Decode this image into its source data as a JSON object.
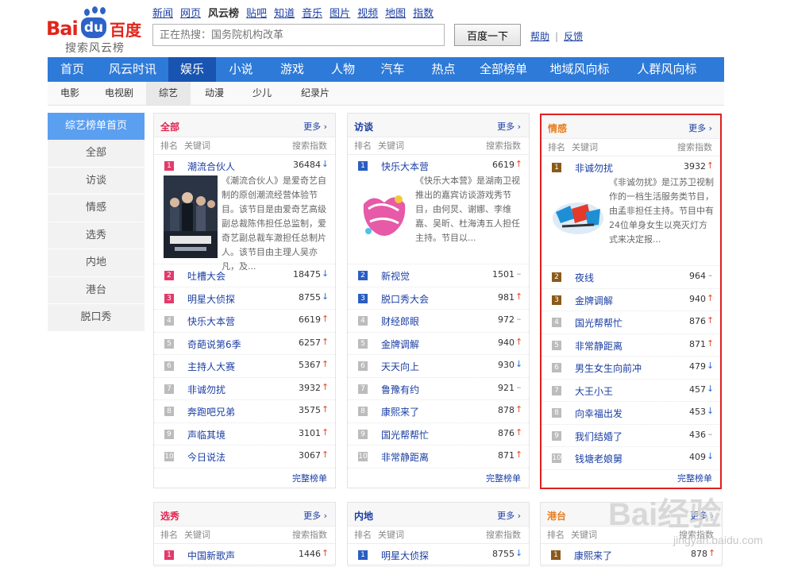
{
  "header": {
    "logo": {
      "bai": "Bai",
      "du": "du",
      "baidu_cn": "百度",
      "subtitle": "搜索风云榜"
    },
    "channels": [
      "新闻",
      "网页",
      "风云榜",
      "贴吧",
      "知道",
      "音乐",
      "图片",
      "视频",
      "地图",
      "指数"
    ],
    "current_channel": "风云榜",
    "search": {
      "placeholder": "正在热搜：国务院机构改革",
      "button": "百度一下"
    },
    "help": "帮助",
    "feedback": "反馈"
  },
  "main_nav": [
    "首页",
    "风云时讯",
    "娱乐",
    "小说",
    "游戏",
    "人物",
    "汽车",
    "热点",
    "全部榜单",
    "地域风向标",
    "人群风向标"
  ],
  "main_nav_active": "娱乐",
  "sub_nav": [
    "电影",
    "电视剧",
    "综艺",
    "动漫",
    "少儿",
    "纪录片"
  ],
  "sub_nav_active": "综艺",
  "sidebar": {
    "head": "综艺榜单首页",
    "items": [
      "全部",
      "访谈",
      "情感",
      "选秀",
      "内地",
      "港台",
      "脱口秀"
    ]
  },
  "common": {
    "more": "更多",
    "rank": "排名",
    "keyword": "关键词",
    "index": "搜索指数",
    "full_list": "完整榜单"
  },
  "colors": {
    "nav_blue": "#2e7ad8",
    "nav_active": "#1854b0",
    "rank_top1": "#e33a6c",
    "rank_top1_gold": "#8b5a1b",
    "rank_top1_blue": "#2b5ec2",
    "highlight_border": "#e02020",
    "up": "#e24a2d",
    "down": "#2f6cd8"
  },
  "panels": [
    {
      "title": "全部",
      "title_color": "#e0244e",
      "rank_color": "#e33a6c",
      "featured": {
        "rank": "1",
        "name": "潮流合伙人",
        "value": "36484",
        "trend": "down",
        "image": "poster-chaoliu-hehuoren",
        "desc": "《潮流合伙人》是爱奇艺自制的原创潮流经营体验节目。该节目是由爱奇艺高级副总裁陈伟担任总监制，爱奇艺副总裁车澈担任总制片人。该节目由主理人吴亦凡，及..."
      },
      "rows": [
        {
          "rank": "2",
          "name": "吐槽大会",
          "value": "18475",
          "trend": "down"
        },
        {
          "rank": "3",
          "name": "明星大侦探",
          "value": "8755",
          "trend": "down"
        },
        {
          "rank": "4",
          "name": "快乐大本营",
          "value": "6619",
          "trend": "up"
        },
        {
          "rank": "5",
          "name": "奇葩说第6季",
          "value": "6257",
          "trend": "up"
        },
        {
          "rank": "6",
          "name": "主持人大赛",
          "value": "5367",
          "trend": "up"
        },
        {
          "rank": "7",
          "name": "非诚勿扰",
          "value": "3932",
          "trend": "up"
        },
        {
          "rank": "8",
          "name": "奔跑吧兄弟",
          "value": "3575",
          "trend": "up"
        },
        {
          "rank": "9",
          "name": "声临其境",
          "value": "3101",
          "trend": "up"
        },
        {
          "rank": "10",
          "name": "今日说法",
          "value": "3067",
          "trend": "up"
        }
      ]
    },
    {
      "title": "访谈",
      "title_color": "#1a3ea3",
      "rank_color": "#2b5ec2",
      "featured": {
        "rank": "1",
        "name": "快乐大本营",
        "value": "6619",
        "trend": "up",
        "image": "logo-kuaile-dabenying",
        "desc": "《快乐大本营》是湖南卫视推出的嘉宾访谈游戏秀节目，由何炅、谢娜、李维嘉、吴昕、杜海涛五人担任主持。节目以..."
      },
      "rows": [
        {
          "rank": "2",
          "name": "新视觉",
          "value": "1501",
          "trend": "flat"
        },
        {
          "rank": "3",
          "name": "脱口秀大会",
          "value": "981",
          "trend": "up"
        },
        {
          "rank": "4",
          "name": "财经郎眼",
          "value": "972",
          "trend": "flat"
        },
        {
          "rank": "5",
          "name": "金牌调解",
          "value": "940",
          "trend": "up"
        },
        {
          "rank": "6",
          "name": "天天向上",
          "value": "930",
          "trend": "down"
        },
        {
          "rank": "7",
          "name": "鲁豫有约",
          "value": "921",
          "trend": "flat"
        },
        {
          "rank": "8",
          "name": "康熙来了",
          "value": "878",
          "trend": "up"
        },
        {
          "rank": "9",
          "name": "国光帮帮忙",
          "value": "876",
          "trend": "up"
        },
        {
          "rank": "10",
          "name": "非常静距离",
          "value": "871",
          "trend": "up"
        }
      ]
    },
    {
      "title": "情感",
      "title_color": "#e67e1e",
      "rank_color": "#8b5a1b",
      "featured": {
        "rank": "1",
        "name": "非诚勿扰",
        "value": "3932",
        "trend": "up",
        "image": "logo-feicheng-wurao",
        "desc": "《非诚勿扰》是江苏卫视制作的一档生活服务类节目，由孟非担任主持。节目中有24位单身女生以亮灭灯方式来决定报..."
      },
      "rows": [
        {
          "rank": "2",
          "name": "夜线",
          "value": "964",
          "trend": "flat"
        },
        {
          "rank": "3",
          "name": "金牌调解",
          "value": "940",
          "trend": "up"
        },
        {
          "rank": "4",
          "name": "国光帮帮忙",
          "value": "876",
          "trend": "up"
        },
        {
          "rank": "5",
          "name": "非常静距离",
          "value": "871",
          "trend": "up"
        },
        {
          "rank": "6",
          "name": "男生女生向前冲",
          "value": "479",
          "trend": "down"
        },
        {
          "rank": "7",
          "name": "大王小王",
          "value": "457",
          "trend": "down"
        },
        {
          "rank": "8",
          "name": "向幸福出发",
          "value": "453",
          "trend": "down"
        },
        {
          "rank": "9",
          "name": "我们结婚了",
          "value": "436",
          "trend": "flat"
        },
        {
          "rank": "10",
          "name": "钱塘老娘舅",
          "value": "409",
          "trend": "down"
        }
      ]
    }
  ],
  "bottom_panels": [
    {
      "title": "选秀",
      "title_color": "#e0244e",
      "rank_color": "#e33a6c",
      "first": {
        "rank": "1",
        "name": "中国新歌声",
        "value": "1446",
        "trend": "up"
      }
    },
    {
      "title": "内地",
      "title_color": "#1a3ea3",
      "rank_color": "#2b5ec2",
      "first": {
        "rank": "1",
        "name": "明星大侦探",
        "value": "8755",
        "trend": "down"
      }
    },
    {
      "title": "港台",
      "title_color": "#e67e1e",
      "rank_color": "#8b5a1b",
      "first": {
        "rank": "1",
        "name": "康熙来了",
        "value": "878",
        "trend": "up"
      }
    }
  ],
  "watermark": {
    "text": "Bai经验",
    "url": "jingyan.baidu.com"
  }
}
